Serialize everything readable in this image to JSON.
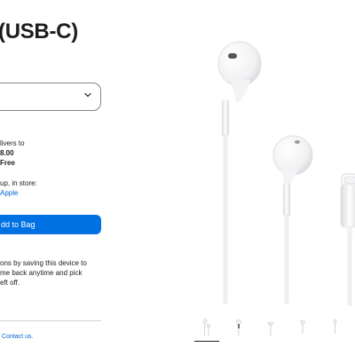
{
  "product": {
    "title": "(USB-C)"
  },
  "delivery": {
    "line1": "livers to",
    "price": "8.00",
    "shipping": "Free"
  },
  "pickup": {
    "line1": "up, in store:",
    "store_link": "Apple"
  },
  "actions": {
    "add_to_bag": "dd to Bag"
  },
  "save_message": {
    "line1": "ons by saving this device to",
    "line2": "me back anytime and pick",
    "line3": "eft off."
  },
  "footer": {
    "contact_link": "Contact us."
  },
  "colors": {
    "accent": "#0071e3",
    "link": "#0066cc",
    "text": "#1d1d1f",
    "border": "#86868b"
  },
  "icons": {
    "dropdown": "chevron-down-icon"
  },
  "gallery": {
    "thumbnail_count": 5,
    "active_thumbnail": 1
  }
}
